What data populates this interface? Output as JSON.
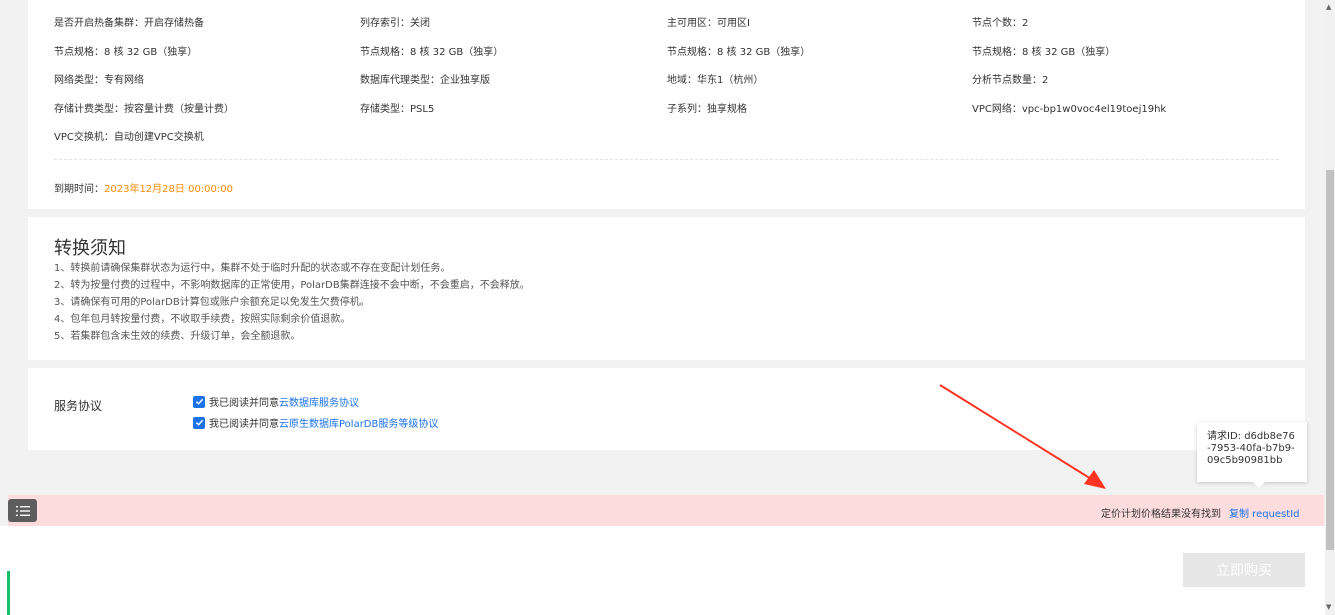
{
  "spec": {
    "rows": [
      [
        "是否开启热备集群：开启存储热备",
        "列存索引：关闭",
        "主可用区：可用区I",
        "节点个数：2"
      ],
      [
        "节点规格：8 核 32 GB（独享）",
        "节点规格：8 核 32 GB（独享）",
        "节点规格：8 核 32 GB（独享）",
        "节点规格：8 核 32 GB（独享）"
      ],
      [
        "网络类型：专有网络",
        "数据库代理类型：企业独享版",
        "地域：华东1（杭州）",
        "分析节点数量：2"
      ],
      [
        "存储计费类型：按容量计费（按量计费）",
        "存储类型：PSL5",
        "子系列：独享规格",
        "VPC网络：vpc-bp1w0voc4el19toej19hk"
      ],
      [
        "VPC交换机：自动创建VPC交换机"
      ]
    ],
    "expire_label": "到期时间：",
    "expire_value": "2023年12月28日 00:00:00"
  },
  "notice": {
    "title": "转换须知",
    "lines": [
      "1、转换前请确保集群状态为运行中，集群不处于临时升配的状态或不存在变配计划任务。",
      "2、转为按量付费的过程中，不影响数据库的正常使用，PolarDB集群连接不会中断，不会重启，不会释放。",
      "3、请确保有可用的PolarDB计算包或账户余额充足以免发生欠费停机。",
      "4、包年包月转按量付费，不收取手续费，按照实际剩余价值退款。",
      "5、若集群包含未生效的续费、升级订单，会全额退款。"
    ]
  },
  "agreement": {
    "label": "服务协议",
    "items": [
      {
        "prefix": "我已阅读并同意",
        "link": "云数据库服务协议"
      },
      {
        "prefix": "我已阅读并同意",
        "link": "云原生数据库PolarDB服务等级协议"
      }
    ]
  },
  "tooltip": {
    "text": "请求ID: d6db8e76-7953-40fa-b7b9-09c5b90981bb"
  },
  "error": {
    "message": "定价计划价格结果没有找到",
    "copy_label": "复制 requestId"
  },
  "buy_button": "立即购买",
  "colors": {
    "accent": "#1a73e8",
    "expire": "#ff8a00",
    "error_bg": "#fcdcdc",
    "arrow": "#ff3322",
    "strip": "#19be6b"
  }
}
